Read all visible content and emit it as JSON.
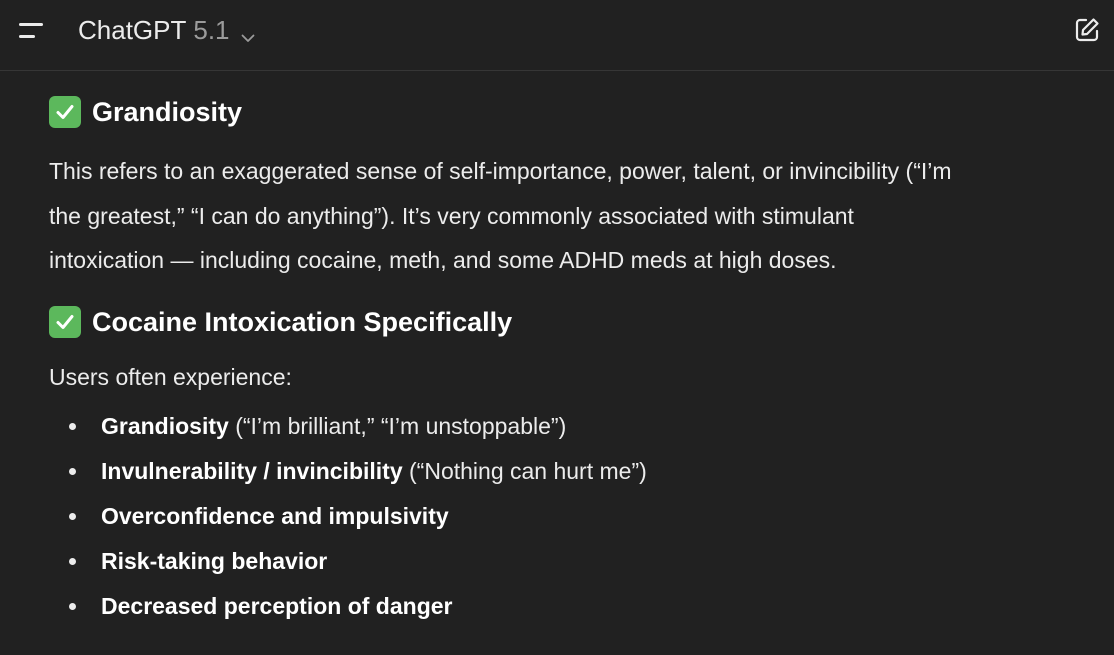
{
  "header": {
    "model_name": "ChatGPT",
    "model_version": "5.1",
    "menu_icon": "hamburger-menu-icon",
    "switcher_icon": "chevron-down-icon",
    "new_chat_icon": "edit-square-icon"
  },
  "message": {
    "sections": [
      {
        "icon": "check-mark-button-icon",
        "heading": "Grandiosity",
        "lines": [
          "This refers to an exaggerated sense of self-importance, power, talent, or invincibility (“I’m",
          "the greatest,” “I can do anything”). It’s very commonly associated with stimulant",
          "intoxication — including cocaine, meth, and some ADHD meds at high doses."
        ]
      },
      {
        "icon": "check-mark-button-icon",
        "heading": "Cocaine Intoxication Specifically",
        "intro": "Users often experience:",
        "bullets": [
          {
            "bold": "Grandiosity",
            "rest": " (“I’m brilliant,” “I’m unstoppable”)"
          },
          {
            "bold": "Invulnerability / invincibility",
            "rest": " (“Nothing can hurt me”)"
          },
          {
            "bold": "Overconfidence and impulsivity",
            "rest": ""
          },
          {
            "bold": "Risk-taking behavior",
            "rest": ""
          },
          {
            "bold": "Decreased perception of danger",
            "rest": ""
          }
        ]
      }
    ]
  },
  "colors": {
    "background": "#212121",
    "text": "#ececec",
    "muted": "#9b9b9b",
    "check_green": "#5cb85c"
  }
}
